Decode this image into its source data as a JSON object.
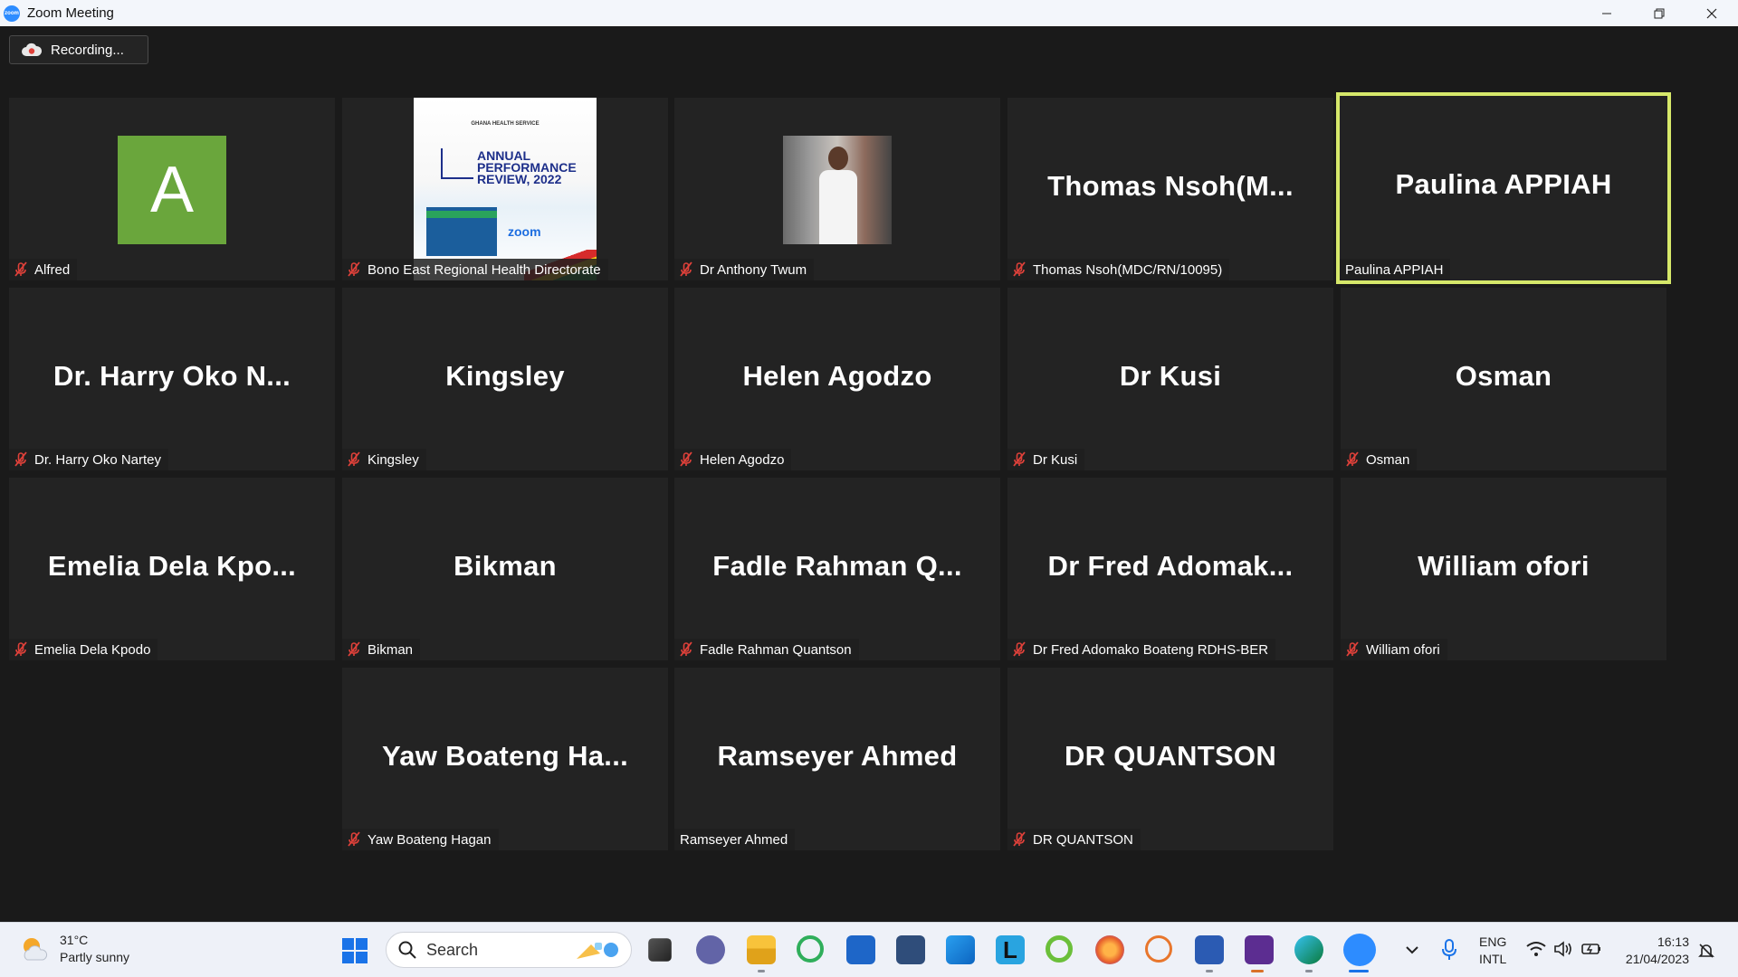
{
  "window": {
    "title": "Zoom Meeting"
  },
  "recording": {
    "label": "Recording..."
  },
  "participants": [
    {
      "display": "",
      "label": "Alfred",
      "muted": true,
      "avatar_letter": "A"
    },
    {
      "display": "",
      "label": "Bono East Regional Health Directorate",
      "muted": true
    },
    {
      "display": "",
      "label": "Dr Anthony Twum",
      "muted": true
    },
    {
      "display": "Thomas  Nsoh(M...",
      "label": "Thomas Nsoh(MDC/RN/10095)",
      "muted": true
    },
    {
      "display": "Paulina APPIAH",
      "label": "Paulina APPIAH",
      "muted": false,
      "active_speaker": true
    },
    {
      "display": "Dr. Harry Oko N...",
      "label": "Dr. Harry Oko Nartey",
      "muted": true
    },
    {
      "display": "Kingsley",
      "label": "Kingsley",
      "muted": true
    },
    {
      "display": "Helen Agodzo",
      "label": "Helen Agodzo",
      "muted": true
    },
    {
      "display": "Dr Kusi",
      "label": "Dr Kusi",
      "muted": true
    },
    {
      "display": "Osman",
      "label": "Osman",
      "muted": true
    },
    {
      "display": "Emelia Dela Kpo...",
      "label": "Emelia Dela Kpodo",
      "muted": true
    },
    {
      "display": "Bikman",
      "label": "Bikman",
      "muted": true
    },
    {
      "display": "Fadle Rahman Q...",
      "label": "Fadle Rahman Quantson",
      "muted": true
    },
    {
      "display": "Dr Fred Adomak...",
      "label": "Dr Fred Adomako Boateng RDHS-BER",
      "muted": true
    },
    {
      "display": "William ofori",
      "label": "William ofori",
      "muted": true
    },
    {
      "display": "Yaw Boateng Ha...",
      "label": "Yaw Boateng Hagan",
      "muted": true
    },
    {
      "display": "Ramseyer Ahmed",
      "label": "Ramseyer Ahmed",
      "muted": false
    },
    {
      "display": "DR QUANTSON",
      "label": "DR QUANTSON",
      "muted": true
    }
  ],
  "poster": {
    "org": "GHANA HEALTH SERVICE",
    "heading_line1": "ANNUAL",
    "heading_line2": "PERFORMANCE",
    "heading_line3": "REVIEW, 2022",
    "zoom_text": "zoom"
  },
  "taskbar": {
    "weather_temp": "31°C",
    "weather_desc": "Partly sunny",
    "search_placeholder": "Search",
    "lang_line1": "ENG",
    "lang_line2": "INTL",
    "time": "16:13",
    "date": "21/04/2023"
  },
  "colors": {
    "active_speaker_border": "#d6e86a",
    "muted_icon": "#e0413a",
    "avatar_bg": "#6aa63c",
    "tile_bg": "#232323",
    "meeting_bg": "#1a1a1a"
  }
}
